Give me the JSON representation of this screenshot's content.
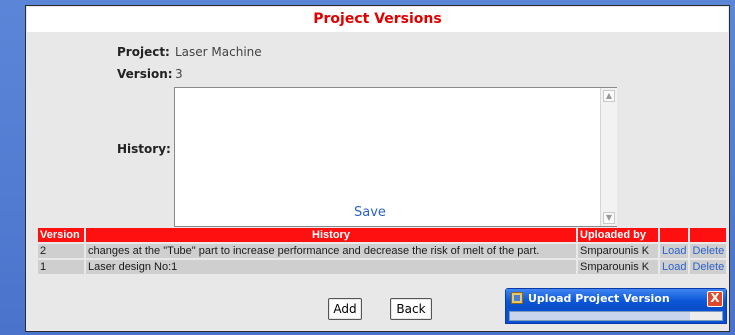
{
  "page": {
    "title": "Project Versions"
  },
  "form": {
    "project_label": "Project:",
    "project_value": "Laser Machine",
    "version_label": "Version:",
    "version_value": "3",
    "history_label": "History:",
    "history_value": "",
    "save_label": "Save"
  },
  "table": {
    "headers": [
      "Version",
      "History",
      "Uploaded by",
      "",
      ""
    ],
    "rows": [
      {
        "version": "2",
        "history": "changes at the \"Tube\" part to increase performance and decrease the risk of melt of the part.",
        "uploaded_by": "Smparounis K",
        "load": "Load",
        "delete": "Delete"
      },
      {
        "version": "1",
        "history": "Laser design No:1",
        "uploaded_by": "Smparounis K",
        "load": "Load",
        "delete": "Delete"
      }
    ]
  },
  "buttons": {
    "add": "Add",
    "back": "Back"
  },
  "upload_dialog": {
    "title": "Upload Project Version",
    "close": "X",
    "progress": 0.85
  },
  "colors": {
    "accent_red": "#ff1010",
    "title_red": "#e00000",
    "link_blue": "#2c62c8",
    "dialog_blue": "#0b57d8"
  },
  "icons": {
    "app_icon": "java-app-icon",
    "close_icon": "close-icon",
    "scroll_up": "scroll-up-icon",
    "scroll_down": "scroll-down-icon"
  }
}
